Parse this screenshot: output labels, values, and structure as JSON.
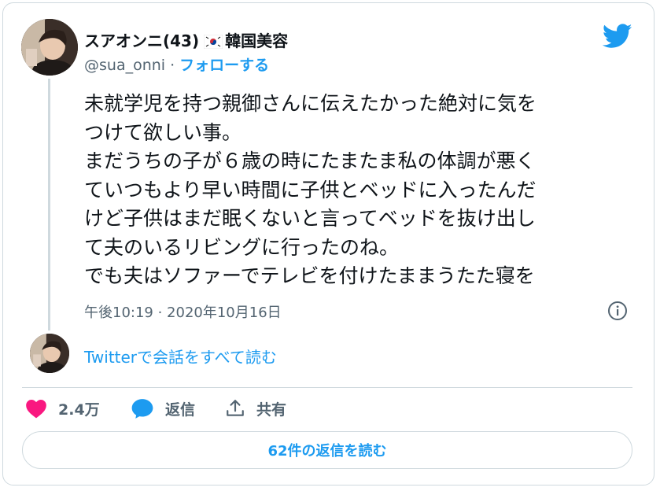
{
  "author": {
    "display_name": "スアオンニ(43)",
    "name_suffix": "韓国美容",
    "handle": "@sua_onni",
    "separator": "·",
    "follow_label": "フォローする"
  },
  "tweet": {
    "lines": [
      "未就学児を持つ親御さんに伝えたかった絶対に気を",
      "つけて欲しい事。",
      "まだうちの子が６歳の時にたまたま私の体調が悪く",
      "ていつもより早い時間に子供とベッドに入ったんだ",
      "けど子供はまだ眠くないと言ってベッドを抜け出し",
      "て夫のいるリビングに行ったのね。",
      "でも夫はソファーでテレビを付けたままうたた寝を"
    ],
    "timestamp": "午後10:19 · 2020年10月16日"
  },
  "conversation": {
    "link_label": "Twitterで会話をすべて読む"
  },
  "actions": {
    "likes": "2.4万",
    "reply_label": "返信",
    "share_label": "共有"
  },
  "footer": {
    "read_replies_label": "62件の返信を読む"
  },
  "colors": {
    "accent": "#1d9bf0",
    "like": "#f91880",
    "secondary_text": "#536471",
    "border": "#cfd9de"
  },
  "icons": [
    "twitter-bird-icon",
    "korea-flag-icon",
    "info-icon",
    "heart-icon",
    "reply-bubble-icon",
    "share-icon"
  ]
}
